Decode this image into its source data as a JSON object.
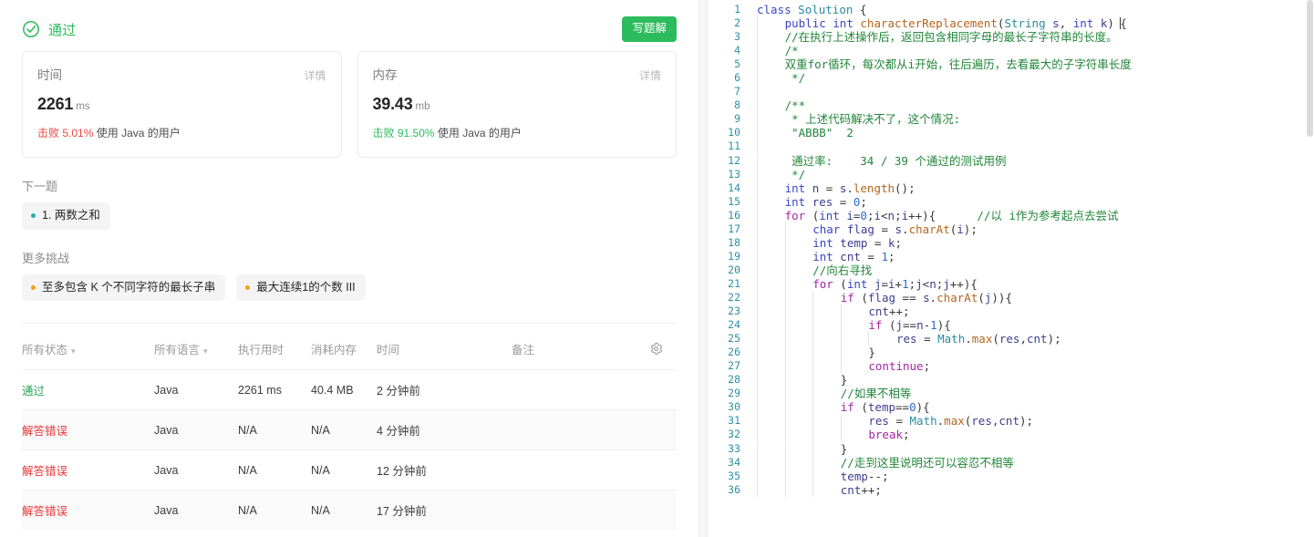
{
  "result": {
    "status_label": "通过",
    "status_icon": "check-circle-icon",
    "status_color": "#2cbb5d",
    "write_solution_label": "写题解"
  },
  "metrics": [
    {
      "title": "时间",
      "detail_label": "详情",
      "value": "2261",
      "unit": "ms",
      "beat_label": "击败",
      "percent": "5.01%",
      "suffix": "使用 Java 的用户",
      "tone": "low",
      "tone_color": "#ef4743"
    },
    {
      "title": "内存",
      "detail_label": "详情",
      "value": "39.43",
      "unit": "mb",
      "beat_label": "击败",
      "percent": "91.50%",
      "suffix": "使用 Java 的用户",
      "tone": "high",
      "tone_color": "#2cbb5d"
    }
  ],
  "next_question": {
    "section_label": "下一题",
    "chips": [
      {
        "label": "1. 两数之和",
        "difficulty": "easy",
        "dot_color": "#20b2a6"
      }
    ]
  },
  "more_challenges": {
    "section_label": "更多挑战",
    "chips": [
      {
        "label": "至多包含 K 个不同字符的最长子串",
        "difficulty": "medium",
        "dot_color": "#f0a30a"
      },
      {
        "label": "最大连续1的个数 III",
        "difficulty": "medium",
        "dot_color": "#f0a30a"
      }
    ]
  },
  "submissions": {
    "headers": [
      {
        "label": "所有状态",
        "has_caret": true
      },
      {
        "label": "所有语言",
        "has_caret": true
      },
      {
        "label": "执行用时",
        "has_caret": false
      },
      {
        "label": "消耗内存",
        "has_caret": false
      },
      {
        "label": "时间",
        "has_caret": false
      },
      {
        "label": "备注",
        "has_caret": false
      }
    ],
    "settings_icon": "gear-icon",
    "rows": [
      {
        "status": "通过",
        "state": "ac",
        "lang": "Java",
        "runtime": "2261 ms",
        "memory": "40.4 MB",
        "when": "2 分钟前",
        "note": ""
      },
      {
        "status": "解答错误",
        "state": "wa",
        "lang": "Java",
        "runtime": "N/A",
        "memory": "N/A",
        "when": "4 分钟前",
        "note": ""
      },
      {
        "status": "解答错误",
        "state": "wa",
        "lang": "Java",
        "runtime": "N/A",
        "memory": "N/A",
        "when": "12 分钟前",
        "note": ""
      },
      {
        "status": "解答错误",
        "state": "wa",
        "lang": "Java",
        "runtime": "N/A",
        "memory": "N/A",
        "when": "17 分钟前",
        "note": ""
      }
    ]
  },
  "editor": {
    "language": "java",
    "lines": [
      {
        "n": 1,
        "indent": 0,
        "tokens": [
          {
            "t": "kw2",
            "v": "class"
          },
          {
            "t": "p",
            "v": " "
          },
          {
            "t": "type",
            "v": "Solution"
          },
          {
            "t": "p",
            "v": " {"
          }
        ]
      },
      {
        "n": 2,
        "indent": 1,
        "tokens": [
          {
            "t": "kw2",
            "v": "public"
          },
          {
            "t": "p",
            "v": " "
          },
          {
            "t": "kw2",
            "v": "int"
          },
          {
            "t": "p",
            "v": " "
          },
          {
            "t": "fn",
            "v": "characterReplacement"
          },
          {
            "t": "p",
            "v": "("
          },
          {
            "t": "type",
            "v": "String"
          },
          {
            "t": "p",
            "v": " "
          },
          {
            "t": "var",
            "v": "s"
          },
          {
            "t": "p",
            "v": ", "
          },
          {
            "t": "kw2",
            "v": "int"
          },
          {
            "t": "p",
            "v": " "
          },
          {
            "t": "var",
            "v": "k"
          },
          {
            "t": "p",
            "v": ") "
          },
          {
            "t": "cursor",
            "v": ""
          },
          {
            "t": "p",
            "v": "{"
          }
        ]
      },
      {
        "n": 3,
        "indent": 1,
        "tokens": [
          {
            "t": "cm",
            "v": "//在执行上述操作后，返回包含相同字母的最长子字符串的长度。"
          }
        ]
      },
      {
        "n": 4,
        "indent": 1,
        "tokens": [
          {
            "t": "cm",
            "v": "/*"
          }
        ]
      },
      {
        "n": 5,
        "indent": 1,
        "tokens": [
          {
            "t": "cm",
            "v": "双重for循环，每次都从i开始，往后遍历，去看最大的子字符串长度"
          }
        ]
      },
      {
        "n": 6,
        "indent": 1,
        "tokens": [
          {
            "t": "cm",
            "v": " */"
          }
        ]
      },
      {
        "n": 7,
        "indent": 1,
        "tokens": []
      },
      {
        "n": 8,
        "indent": 1,
        "tokens": [
          {
            "t": "cm",
            "v": "/**"
          }
        ]
      },
      {
        "n": 9,
        "indent": 1,
        "tokens": [
          {
            "t": "cm",
            "v": " * 上述代码解决不了，这个情况:"
          }
        ]
      },
      {
        "n": 10,
        "indent": 1,
        "tokens": [
          {
            "t": "cm",
            "v": " \"ABBB\"  2"
          }
        ]
      },
      {
        "n": 11,
        "indent": 1,
        "tokens": []
      },
      {
        "n": 12,
        "indent": 1,
        "tokens": [
          {
            "t": "cm",
            "v": " 通过率:    34 / 39 个通过的测试用例"
          }
        ]
      },
      {
        "n": 13,
        "indent": 1,
        "tokens": [
          {
            "t": "cm",
            "v": " */"
          }
        ]
      },
      {
        "n": 14,
        "indent": 1,
        "tokens": [
          {
            "t": "kw2",
            "v": "int"
          },
          {
            "t": "p",
            "v": " "
          },
          {
            "t": "var",
            "v": "n"
          },
          {
            "t": "p",
            "v": " = "
          },
          {
            "t": "var",
            "v": "s"
          },
          {
            "t": "p",
            "v": "."
          },
          {
            "t": "fn",
            "v": "length"
          },
          {
            "t": "p",
            "v": "();"
          }
        ]
      },
      {
        "n": 15,
        "indent": 1,
        "tokens": [
          {
            "t": "kw2",
            "v": "int"
          },
          {
            "t": "p",
            "v": " "
          },
          {
            "t": "var",
            "v": "res"
          },
          {
            "t": "p",
            "v": " = "
          },
          {
            "t": "num",
            "v": "0"
          },
          {
            "t": "p",
            "v": ";"
          }
        ]
      },
      {
        "n": 16,
        "indent": 1,
        "tokens": [
          {
            "t": "kw",
            "v": "for"
          },
          {
            "t": "p",
            "v": " ("
          },
          {
            "t": "kw2",
            "v": "int"
          },
          {
            "t": "p",
            "v": " "
          },
          {
            "t": "var",
            "v": "i"
          },
          {
            "t": "p",
            "v": "="
          },
          {
            "t": "num",
            "v": "0"
          },
          {
            "t": "p",
            "v": ";"
          },
          {
            "t": "var",
            "v": "i"
          },
          {
            "t": "p",
            "v": "<"
          },
          {
            "t": "var",
            "v": "n"
          },
          {
            "t": "p",
            "v": ";"
          },
          {
            "t": "var",
            "v": "i"
          },
          {
            "t": "p",
            "v": "++){"
          },
          {
            "t": "p",
            "v": "      "
          },
          {
            "t": "cm",
            "v": "//以 i作为参考起点去尝试"
          }
        ]
      },
      {
        "n": 17,
        "indent": 2,
        "tokens": [
          {
            "t": "kw2",
            "v": "char"
          },
          {
            "t": "p",
            "v": " "
          },
          {
            "t": "var",
            "v": "flag"
          },
          {
            "t": "p",
            "v": " = "
          },
          {
            "t": "var",
            "v": "s"
          },
          {
            "t": "p",
            "v": "."
          },
          {
            "t": "fn",
            "v": "charAt"
          },
          {
            "t": "p",
            "v": "("
          },
          {
            "t": "var",
            "v": "i"
          },
          {
            "t": "p",
            "v": ");"
          }
        ]
      },
      {
        "n": 18,
        "indent": 2,
        "tokens": [
          {
            "t": "kw2",
            "v": "int"
          },
          {
            "t": "p",
            "v": " "
          },
          {
            "t": "var",
            "v": "temp"
          },
          {
            "t": "p",
            "v": " = "
          },
          {
            "t": "var",
            "v": "k"
          },
          {
            "t": "p",
            "v": ";"
          }
        ]
      },
      {
        "n": 19,
        "indent": 2,
        "tokens": [
          {
            "t": "kw2",
            "v": "int"
          },
          {
            "t": "p",
            "v": " "
          },
          {
            "t": "var",
            "v": "cnt"
          },
          {
            "t": "p",
            "v": " = "
          },
          {
            "t": "num",
            "v": "1"
          },
          {
            "t": "p",
            "v": ";"
          }
        ]
      },
      {
        "n": 20,
        "indent": 2,
        "tokens": [
          {
            "t": "cm",
            "v": "//向右寻找"
          }
        ]
      },
      {
        "n": 21,
        "indent": 2,
        "tokens": [
          {
            "t": "kw",
            "v": "for"
          },
          {
            "t": "p",
            "v": " ("
          },
          {
            "t": "kw2",
            "v": "int"
          },
          {
            "t": "p",
            "v": " "
          },
          {
            "t": "var",
            "v": "j"
          },
          {
            "t": "p",
            "v": "="
          },
          {
            "t": "var",
            "v": "i"
          },
          {
            "t": "p",
            "v": "+"
          },
          {
            "t": "num",
            "v": "1"
          },
          {
            "t": "p",
            "v": ";"
          },
          {
            "t": "var",
            "v": "j"
          },
          {
            "t": "p",
            "v": "<"
          },
          {
            "t": "var",
            "v": "n"
          },
          {
            "t": "p",
            "v": ";"
          },
          {
            "t": "var",
            "v": "j"
          },
          {
            "t": "p",
            "v": "++){"
          }
        ]
      },
      {
        "n": 22,
        "indent": 3,
        "tokens": [
          {
            "t": "kw",
            "v": "if"
          },
          {
            "t": "p",
            "v": " ("
          },
          {
            "t": "var",
            "v": "flag"
          },
          {
            "t": "p",
            "v": " == "
          },
          {
            "t": "var",
            "v": "s"
          },
          {
            "t": "p",
            "v": "."
          },
          {
            "t": "fn",
            "v": "charAt"
          },
          {
            "t": "p",
            "v": "("
          },
          {
            "t": "var",
            "v": "j"
          },
          {
            "t": "p",
            "v": ")){"
          }
        ]
      },
      {
        "n": 23,
        "indent": 4,
        "tokens": [
          {
            "t": "var",
            "v": "cnt"
          },
          {
            "t": "p",
            "v": "++;"
          }
        ]
      },
      {
        "n": 24,
        "indent": 4,
        "tokens": [
          {
            "t": "kw",
            "v": "if"
          },
          {
            "t": "p",
            "v": " ("
          },
          {
            "t": "var",
            "v": "j"
          },
          {
            "t": "p",
            "v": "=="
          },
          {
            "t": "var",
            "v": "n"
          },
          {
            "t": "p",
            "v": "-"
          },
          {
            "t": "num",
            "v": "1"
          },
          {
            "t": "p",
            "v": "){"
          }
        ]
      },
      {
        "n": 25,
        "indent": 5,
        "tokens": [
          {
            "t": "var",
            "v": "res"
          },
          {
            "t": "p",
            "v": " = "
          },
          {
            "t": "type",
            "v": "Math"
          },
          {
            "t": "p",
            "v": "."
          },
          {
            "t": "fn",
            "v": "max"
          },
          {
            "t": "p",
            "v": "("
          },
          {
            "t": "var",
            "v": "res"
          },
          {
            "t": "p",
            "v": ","
          },
          {
            "t": "var",
            "v": "cnt"
          },
          {
            "t": "p",
            "v": ");"
          }
        ]
      },
      {
        "n": 26,
        "indent": 4,
        "tokens": [
          {
            "t": "p",
            "v": "}"
          }
        ]
      },
      {
        "n": 27,
        "indent": 4,
        "tokens": [
          {
            "t": "kw",
            "v": "continue"
          },
          {
            "t": "p",
            "v": ";"
          }
        ]
      },
      {
        "n": 28,
        "indent": 3,
        "tokens": [
          {
            "t": "p",
            "v": "}"
          }
        ]
      },
      {
        "n": 29,
        "indent": 3,
        "tokens": [
          {
            "t": "cm",
            "v": "//如果不相等"
          }
        ]
      },
      {
        "n": 30,
        "indent": 3,
        "tokens": [
          {
            "t": "kw",
            "v": "if"
          },
          {
            "t": "p",
            "v": " ("
          },
          {
            "t": "var",
            "v": "temp"
          },
          {
            "t": "p",
            "v": "=="
          },
          {
            "t": "num",
            "v": "0"
          },
          {
            "t": "p",
            "v": "){"
          }
        ]
      },
      {
        "n": 31,
        "indent": 4,
        "tokens": [
          {
            "t": "var",
            "v": "res"
          },
          {
            "t": "p",
            "v": " = "
          },
          {
            "t": "type",
            "v": "Math"
          },
          {
            "t": "p",
            "v": "."
          },
          {
            "t": "fn",
            "v": "max"
          },
          {
            "t": "p",
            "v": "("
          },
          {
            "t": "var",
            "v": "res"
          },
          {
            "t": "p",
            "v": ","
          },
          {
            "t": "var",
            "v": "cnt"
          },
          {
            "t": "p",
            "v": ");"
          }
        ]
      },
      {
        "n": 32,
        "indent": 4,
        "tokens": [
          {
            "t": "kw",
            "v": "break"
          },
          {
            "t": "p",
            "v": ";"
          }
        ]
      },
      {
        "n": 33,
        "indent": 3,
        "tokens": [
          {
            "t": "p",
            "v": "}"
          }
        ]
      },
      {
        "n": 34,
        "indent": 3,
        "tokens": [
          {
            "t": "cm",
            "v": "//走到这里说明还可以容忍不相等"
          }
        ]
      },
      {
        "n": 35,
        "indent": 3,
        "tokens": [
          {
            "t": "var",
            "v": "temp"
          },
          {
            "t": "p",
            "v": "--;"
          }
        ]
      },
      {
        "n": 36,
        "indent": 3,
        "tokens": [
          {
            "t": "var",
            "v": "cnt"
          },
          {
            "t": "p",
            "v": "++;"
          }
        ]
      }
    ]
  }
}
